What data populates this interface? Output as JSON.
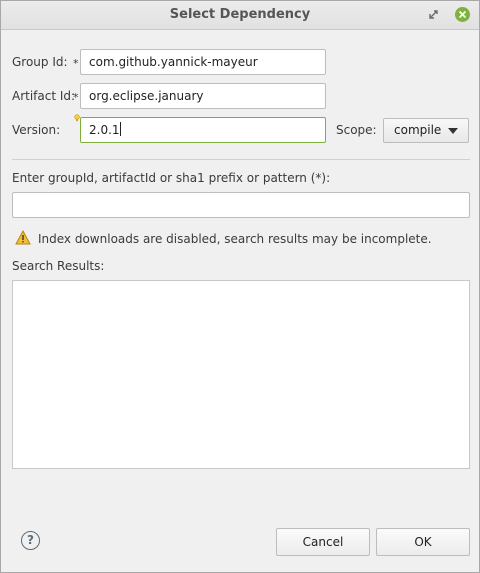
{
  "window": {
    "title": "Select Dependency"
  },
  "form": {
    "group_id_label": "Group Id:",
    "group_id_value": "com.github.yannick-mayeur",
    "artifact_id_label": "Artifact Id:",
    "artifact_id_value": "org.eclipse.january",
    "version_label": "Version:",
    "version_value": "2.0.1",
    "required_marker": "*",
    "scope_label": "Scope:",
    "scope_value": "compile"
  },
  "search": {
    "label": "Enter groupId, artifactId or sha1 prefix or pattern (*):",
    "value": "",
    "warning": "Index downloads are disabled, search results may be incomplete.",
    "results_label": "Search Results:"
  },
  "footer": {
    "help": "?",
    "cancel_label": "Cancel",
    "ok_label": "OK"
  },
  "icons": {
    "restore": "restore-icon",
    "close": "close-icon",
    "warning": "warning-icon",
    "help": "help-icon",
    "hint": "content-assist-hint-icon",
    "dropdown": "chevron-down-icon"
  },
  "colors": {
    "accent": "#7eb23c",
    "focus_border": "#7fb03e",
    "warning": "#f0c038"
  }
}
